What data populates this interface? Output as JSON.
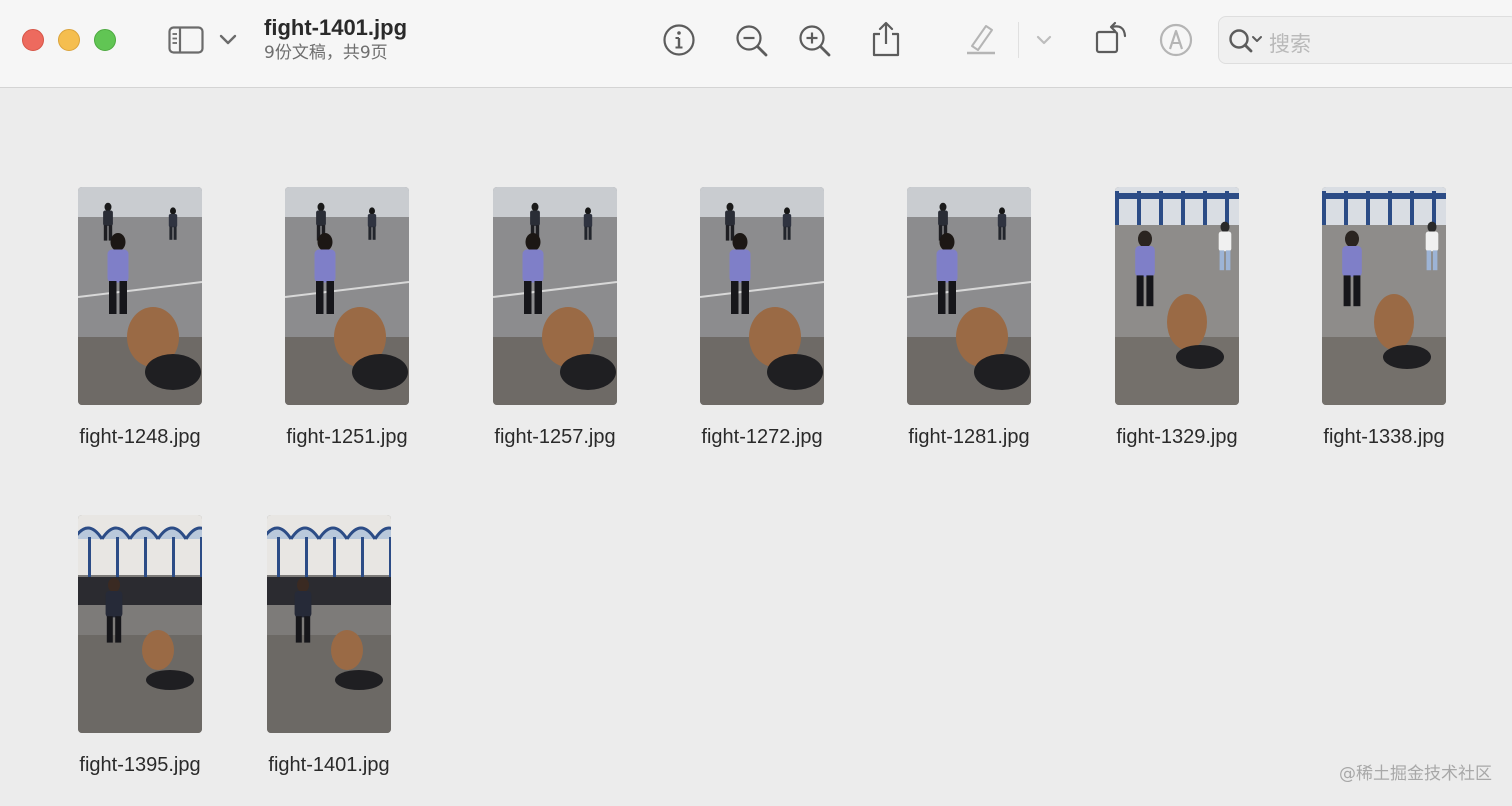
{
  "window": {
    "title": "fight-1401.jpg",
    "subtitle": "9份文稿，共9页"
  },
  "toolbar": {
    "search_placeholder": "搜索",
    "icons": [
      "sidebar-icon",
      "chevron-down-icon",
      "info-icon",
      "zoom-out-icon",
      "zoom-in-icon",
      "share-icon",
      "highlighter-icon",
      "chevron-down-icon",
      "rotate-icon",
      "markup-icon",
      "search-icon"
    ]
  },
  "thumbnails": [
    {
      "name": "fight-1248.jpg",
      "scene": "square"
    },
    {
      "name": "fight-1251.jpg",
      "scene": "square"
    },
    {
      "name": "fight-1257.jpg",
      "scene": "square"
    },
    {
      "name": "fight-1272.jpg",
      "scene": "square"
    },
    {
      "name": "fight-1281.jpg",
      "scene": "square"
    },
    {
      "name": "fight-1329.jpg",
      "scene": "canopy"
    },
    {
      "name": "fight-1338.jpg",
      "scene": "canopy"
    },
    {
      "name": "fight-1395.jpg",
      "scene": "arches"
    },
    {
      "name": "fight-1401.jpg",
      "scene": "arches"
    }
  ],
  "watermark": "@稀土掘金技术社区",
  "colors": {
    "toolbar_bg": "#f6f6f6",
    "window_bg": "#ececec",
    "close": "#ed6a5e",
    "minimize": "#f5be4f",
    "maximize": "#61c554"
  }
}
